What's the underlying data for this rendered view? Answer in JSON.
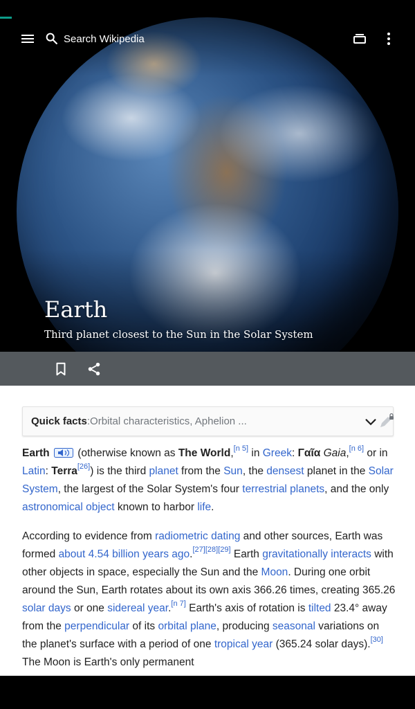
{
  "toolbar": {
    "search_placeholder": "Search Wikipedia"
  },
  "hero": {
    "title": "Earth",
    "subtitle": "Third planet closest to the Sun in the Solar System"
  },
  "quick_facts": {
    "label": "Quick facts",
    "separator": ": ",
    "summary": "Orbital characteristics, Aphelion ..."
  },
  "article": {
    "p1": {
      "b_earth": "Earth",
      "t1": " (otherwise known as ",
      "b_world": "The World",
      "t2": ",",
      "ref_n5": "[n 5]",
      "t3": " in ",
      "l_greek": "Greek",
      "t4": ": ",
      "b_gaia": "Γαῖα",
      "i_gaia": " Gaia",
      "t5": ",",
      "ref_n6": "[n 6]",
      "t6": " or in ",
      "l_latin": "Latin",
      "t7": ": ",
      "b_terra": "Terra",
      "ref_26": "[26]",
      "t8": ") is the third ",
      "l_planet": "planet",
      "t9": " from the ",
      "l_sun": "Sun",
      "t10": ", the ",
      "l_densest": "densest",
      "t11": " planet in the ",
      "l_solar_system": "Solar System",
      "t12": ", the largest of the Solar System's four ",
      "l_terrestrial": "terrestrial planets",
      "t13": ", and the only ",
      "l_astro": "astronomical object",
      "t14": " known to harbor ",
      "l_life": "life",
      "t15": "."
    },
    "p2": {
      "t1": "According to evidence from ",
      "l_radiometric": "radiometric dating",
      "t2": " and other sources, Earth was formed ",
      "l_age": "about 4.54 billion years ago",
      "t3": ".",
      "ref_27": "[27]",
      "ref_28": "[28]",
      "ref_29": "[29]",
      "t4": " Earth ",
      "l_grav": "gravitationally interacts",
      "t5": " with other objects in space, especially the Sun and the ",
      "l_moon": "Moon",
      "t6": ". During one orbit around the Sun, Earth rotates about its own axis 366.26 times, creating 365.26 ",
      "l_solar_days": "solar days",
      "t7": " or one ",
      "l_sidereal": "sidereal year",
      "t8": ".",
      "ref_n7": "[n 7]",
      "t9": " Earth's axis of rotation is ",
      "l_tilted": "tilted",
      "t10": " 23.4° away from the ",
      "l_perpendicular": "perpendicular",
      "t11": " of its ",
      "l_orbital_plane": "orbital plane",
      "t12": ", producing ",
      "l_seasonal": "seasonal",
      "t13": " variations on the planet's surface with a period of one ",
      "l_tropical": "tropical year",
      "t14": " (365.24 solar days).",
      "ref_30": "[30]",
      "t15": " The Moon is Earth's only permanent"
    }
  },
  "colors": {
    "link": "#3366cc",
    "action_bar": "#54595d",
    "accent": "#0d9c8a",
    "text": "#222222",
    "muted": "#72777d"
  },
  "icons": [
    "menu-icon",
    "search-icon",
    "tabs-icon",
    "more-vert-icon",
    "bookmark-icon",
    "share-icon",
    "chevron-down-icon",
    "edit-lock-icon",
    "audio-icon"
  ]
}
